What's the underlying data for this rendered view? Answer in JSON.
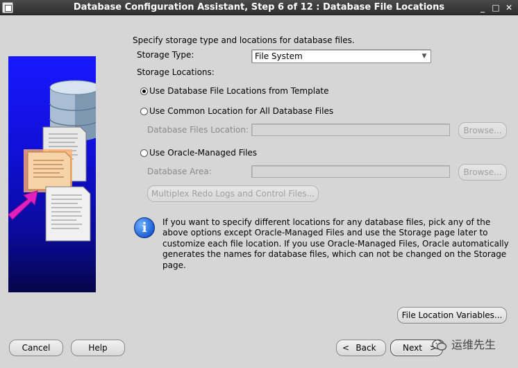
{
  "window": {
    "title": "Database Configuration Assistant, Step 6 of 12 : Database File Locations",
    "buttons": {
      "minimize": "_",
      "maximize": "□",
      "close": "✕"
    }
  },
  "main": {
    "instruction": "Specify storage type and locations for database files.",
    "storage_type_label": "Storage Type:",
    "storage_type_value": "File System",
    "storage_locations_label": "Storage Locations:",
    "option_template": "Use Database File Locations from Template",
    "option_common": "Use Common Location for All Database Files",
    "db_files_location_label": "Database Files Location:",
    "db_files_location_value": "",
    "browse_label": "Browse...",
    "option_omf": "Use Oracle-Managed Files",
    "db_area_label": "Database Area:",
    "db_area_value": "",
    "multiplex_button": "Multiplex Redo Logs and Control Files...",
    "info_text": "If you want to specify different locations for any database files, pick any of the above options except Oracle-Managed Files and use the Storage page later to customize each file location. If you use Oracle-Managed Files, Oracle automatically generates the names for database files, which can not be changed on the Storage page.",
    "file_location_variables_button": "File Location Variables...",
    "selected_option": "template"
  },
  "footer": {
    "cancel": "Cancel",
    "help": "Help",
    "back": "Back",
    "next": "Next",
    "watermark": "运维先生"
  },
  "colors": {
    "background": "#d6d6d6",
    "panel_top": "#1818ff",
    "panel_bottom": "#05054a",
    "arrow": "#e020c0",
    "info_icon": "#1d5fd6"
  },
  "icons": {
    "window": "app-icon",
    "info": "info-icon",
    "dropdown": "chevron-down-icon",
    "back": "chevron-left-icon",
    "next": "chevron-right-icon",
    "watermark": "wechat-icon"
  }
}
